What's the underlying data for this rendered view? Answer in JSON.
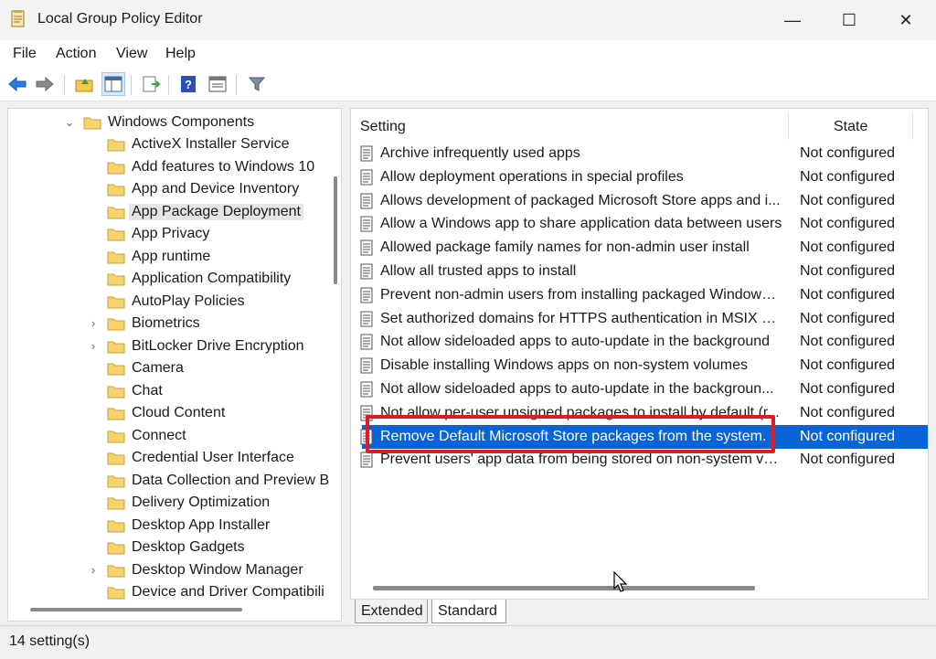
{
  "window": {
    "title": "Local Group Policy Editor",
    "controls": {
      "minimize": "—",
      "maximize": "☐",
      "close": "✕"
    }
  },
  "menu": {
    "file": "File",
    "action": "Action",
    "view": "View",
    "help": "Help"
  },
  "toolbar": {
    "buttons": [
      "back-icon",
      "forward-icon",
      "up-folder-icon",
      "show-hide-tree-icon",
      "export-list-icon",
      "help-icon",
      "properties-icon",
      "filter-icon"
    ]
  },
  "tree": {
    "parent": {
      "label": "Windows Components",
      "expanded": true
    },
    "items": [
      {
        "label": "ActiveX Installer Service",
        "expandable": false
      },
      {
        "label": "Add features to Windows 10",
        "expandable": false
      },
      {
        "label": "App and Device Inventory",
        "expandable": false
      },
      {
        "label": "App Package Deployment",
        "expandable": false,
        "selected": true
      },
      {
        "label": "App Privacy",
        "expandable": false
      },
      {
        "label": "App runtime",
        "expandable": false
      },
      {
        "label": "Application Compatibility",
        "expandable": false
      },
      {
        "label": "AutoPlay Policies",
        "expandable": false
      },
      {
        "label": "Biometrics",
        "expandable": true
      },
      {
        "label": "BitLocker Drive Encryption",
        "expandable": true
      },
      {
        "label": "Camera",
        "expandable": false
      },
      {
        "label": "Chat",
        "expandable": false
      },
      {
        "label": "Cloud Content",
        "expandable": false
      },
      {
        "label": "Connect",
        "expandable": false
      },
      {
        "label": "Credential User Interface",
        "expandable": false
      },
      {
        "label": "Data Collection and Preview B",
        "expandable": false
      },
      {
        "label": "Delivery Optimization",
        "expandable": false
      },
      {
        "label": "Desktop App Installer",
        "expandable": false
      },
      {
        "label": "Desktop Gadgets",
        "expandable": false
      },
      {
        "label": "Desktop Window Manager",
        "expandable": true
      },
      {
        "label": "Device and Driver Compatibili",
        "expandable": false
      }
    ]
  },
  "list": {
    "columns": {
      "setting": "Setting",
      "state": "State"
    },
    "rows": [
      {
        "name": "Archive infrequently used apps",
        "state": "Not configured"
      },
      {
        "name": "Allow deployment operations in special profiles",
        "state": "Not configured"
      },
      {
        "name": "Allows development of packaged Microsoft Store apps and i...",
        "state": "Not configured"
      },
      {
        "name": "Allow a Windows app to share application data between users",
        "state": "Not configured"
      },
      {
        "name": "Allowed package family names for non-admin user install",
        "state": "Not configured"
      },
      {
        "name": "Allow all trusted apps to install",
        "state": "Not configured"
      },
      {
        "name": "Prevent non-admin users from installing packaged Windows ...",
        "state": "Not configured"
      },
      {
        "name": "Set authorized domains for HTTPS authentication in MSIX str...",
        "state": "Not configured"
      },
      {
        "name": "Not allow sideloaded apps to auto-update in the background",
        "state": "Not configured"
      },
      {
        "name": "Disable installing Windows apps on non-system volumes",
        "state": "Not configured"
      },
      {
        "name": "Not allow sideloaded apps to auto-update in the backgroun...",
        "state": "Not configured"
      },
      {
        "name": "Not allow per-user unsigned packages to install by default (r...",
        "state": "Not configured"
      },
      {
        "name": "Remove Default Microsoft Store packages from the system.",
        "state": "Not configured",
        "selected": true
      },
      {
        "name": "Prevent users' app data from being stored on non-system vo...",
        "state": "Not configured"
      }
    ]
  },
  "tabs": {
    "extended": "Extended",
    "standard": "Standard"
  },
  "status": {
    "text": "14 setting(s)"
  },
  "colors": {
    "selection": "#0a64d8",
    "highlight_box": "#e11b22"
  }
}
